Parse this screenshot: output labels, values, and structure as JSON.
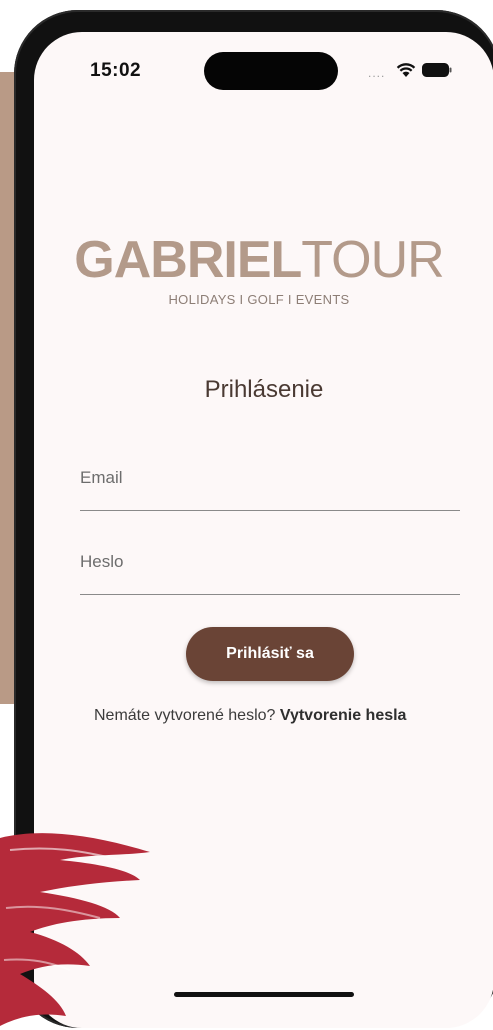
{
  "status_bar": {
    "time": "15:02",
    "signal": "....",
    "wifi_icon": "wifi-icon",
    "battery_icon": "battery-icon"
  },
  "brand": {
    "logo_bold": "GABRIEL",
    "logo_light": "TOUR",
    "tagline": "HOLIDAYS I GOLF I EVENTS",
    "logo_color": "#b39a8a"
  },
  "login": {
    "title": "Prihlásenie",
    "email_label": "Email",
    "password_label": "Heslo",
    "submit_label": "Prihlásiť sa",
    "no_password_text": "Nemáte vytvorené heslo? ",
    "create_password_link": "Vytvorenie hesla",
    "button_color": "#6a4436"
  },
  "decor": {
    "block_color": "#b99a86",
    "brush_color": "#b52a3a"
  }
}
